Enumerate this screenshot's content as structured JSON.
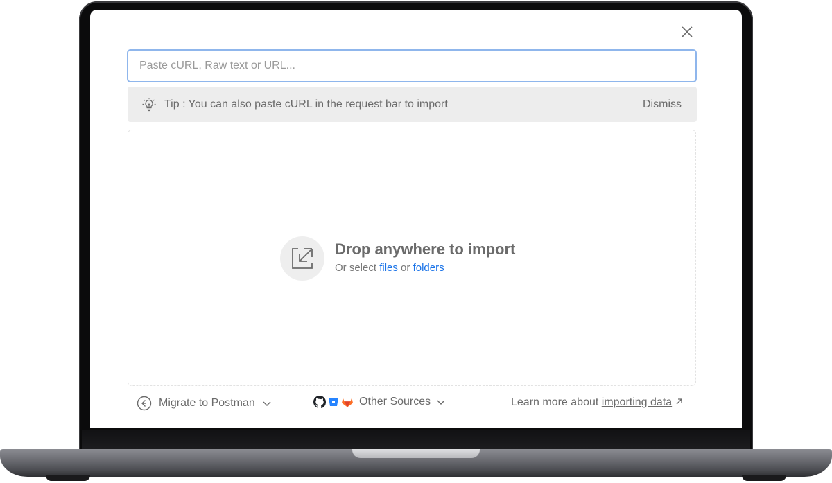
{
  "modal": {
    "close_icon": "close-icon",
    "url_input": {
      "placeholder": "Paste cURL, Raw text or URL...",
      "value": ""
    },
    "tip": {
      "icon": "lightbulb-icon",
      "text": "Tip : You can also paste cURL in the request bar to import",
      "dismiss_label": "Dismiss"
    },
    "dropzone": {
      "icon": "import-arrow-icon",
      "title": "Drop anywhere to import",
      "sub_prefix": "Or select",
      "files_link": "files",
      "or_text": "or",
      "folders_link": "folders"
    },
    "footer": {
      "migrate_label": "Migrate to Postman",
      "migrate_icon": "migrate-icon",
      "other_sources_label": "Other Sources",
      "other_source_icons": [
        "github-icon",
        "bitbucket-icon",
        "gitlab-icon"
      ],
      "learn_prefix": "Learn more about",
      "learn_link": "importing data",
      "learn_icon": "external-arrow-icon"
    }
  },
  "colors": {
    "input_border": "#8fb6ec",
    "link": "#1a73e8",
    "tip_bg": "#ededed",
    "bitbucket": "#2684ff",
    "gitlab": "#e24329"
  }
}
